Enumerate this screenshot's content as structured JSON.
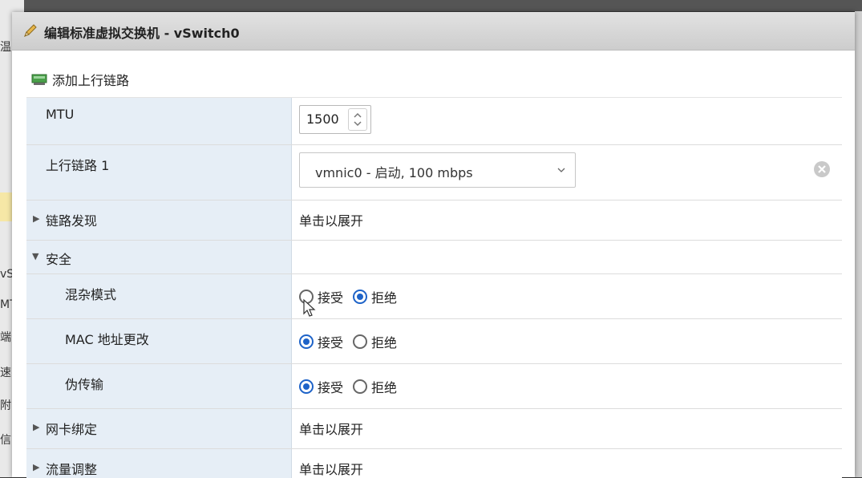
{
  "dialog": {
    "title": "编辑标准虚拟交换机 - vSwitch0",
    "toolbar": {
      "add_uplink_label": "添加上行链路"
    }
  },
  "rows": {
    "mtu": {
      "label": "MTU",
      "value": "1500"
    },
    "uplink1": {
      "label": "上行链路 1",
      "value": "vmnic0 - 启动, 100 mbps"
    },
    "link_discovery": {
      "label": "链路发现",
      "value": "单击以展开"
    },
    "security": {
      "label": "安全",
      "promiscuous": {
        "label": "混杂模式",
        "accept": "接受",
        "reject": "拒绝",
        "selected": "拒绝"
      },
      "mac_change": {
        "label": "MAC 地址更改",
        "accept": "接受",
        "reject": "拒绝",
        "selected": "接受"
      },
      "forged": {
        "label": "伪传输",
        "accept": "接受",
        "reject": "拒绝",
        "selected": "接受"
      }
    },
    "nic_teaming": {
      "label": "网卡绑定",
      "value": "单击以展开"
    },
    "traffic_shaping": {
      "label": "流量调整",
      "value": "单击以展开"
    }
  },
  "background": {
    "fragments": [
      "温",
      "vS",
      "MT",
      "端",
      "速",
      "附",
      "信"
    ]
  },
  "colors": {
    "label_bg": "#e6eef6",
    "radio_accent": "#1e63c8",
    "header_bg": "#d6d6d6"
  },
  "icons": {
    "title": "pencil-icon",
    "toolbar": "network-adapter-icon",
    "remove": "remove-circle-icon",
    "dropdown": "chevron-down-icon",
    "spinner": "spinner-arrows-icon"
  }
}
